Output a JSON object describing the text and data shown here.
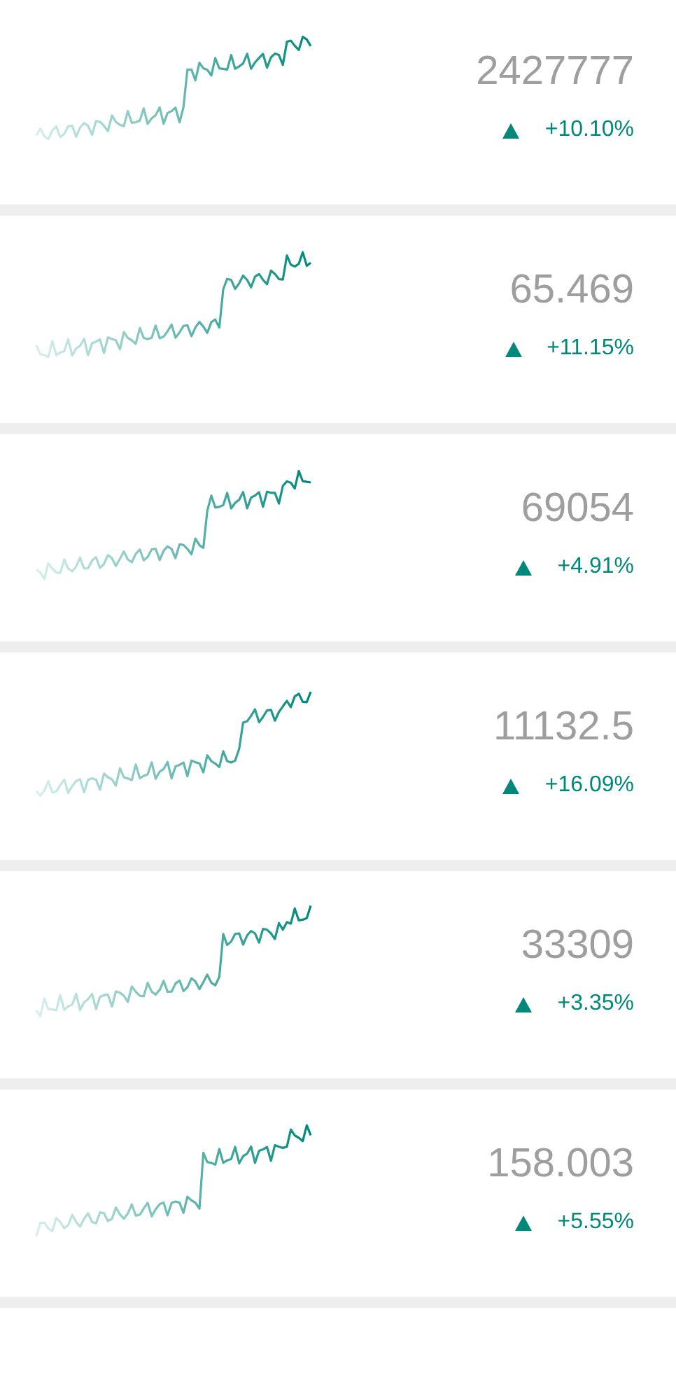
{
  "rows": [
    {
      "value": "2427777",
      "change": "+10.10%"
    },
    {
      "value": "65.469",
      "change": "+11.15%"
    },
    {
      "value": "69054",
      "change": "+4.91%"
    },
    {
      "value": "11132.5",
      "change": "+16.09%"
    },
    {
      "value": "33309",
      "change": "+3.35%"
    },
    {
      "value": "158.003",
      "change": "+5.55%"
    }
  ]
}
